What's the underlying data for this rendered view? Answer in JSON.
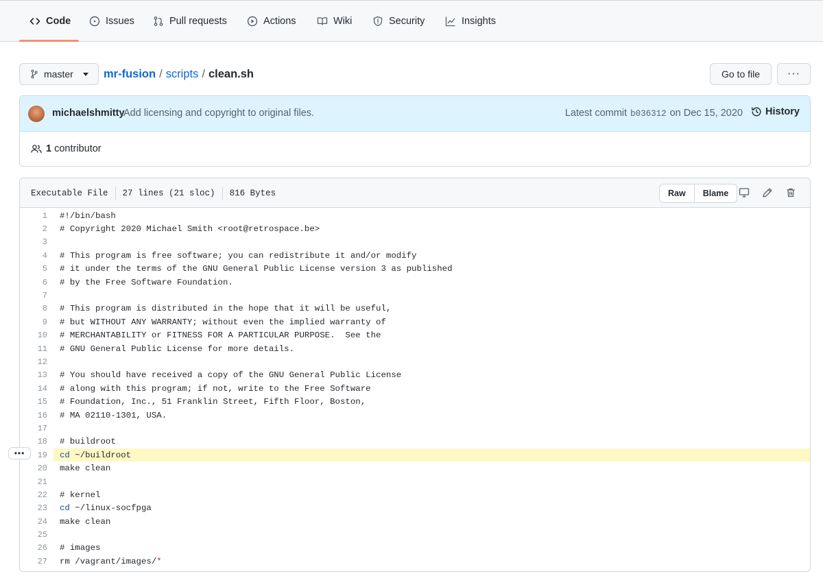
{
  "nav": {
    "tabs": [
      {
        "label": "Code",
        "icon": "code-icon"
      },
      {
        "label": "Issues",
        "icon": "issue-opened-icon"
      },
      {
        "label": "Pull requests",
        "icon": "git-pull-request-icon"
      },
      {
        "label": "Actions",
        "icon": "play-icon"
      },
      {
        "label": "Wiki",
        "icon": "book-icon"
      },
      {
        "label": "Security",
        "icon": "shield-icon"
      },
      {
        "label": "Insights",
        "icon": "graph-icon"
      }
    ],
    "selected": "Code"
  },
  "breadcrumb": {
    "branch": "master",
    "repo": "mr-fusion",
    "sep": "/",
    "dir": "scripts",
    "file": "clean.sh",
    "goto_label": "Go to file",
    "more_label": "···"
  },
  "commit": {
    "author": "michaelshmitty",
    "message": "Add licensing and copyright to original files.",
    "latest_label": "Latest commit",
    "sha": "b036312",
    "date": "on Dec 15, 2020",
    "history_label": "History",
    "contributor_count": "1",
    "contributor_label": "contributor"
  },
  "file": {
    "type": "Executable File",
    "lines": "27 lines (21 sloc)",
    "size": "816 Bytes",
    "raw_label": "Raw",
    "blame_label": "Blame",
    "highlighted_line": 19,
    "code": [
      "#!/bin/bash",
      "# Copyright 2020 Michael Smith <root@retrospace.be>",
      "",
      "# This program is free software; you can redistribute it and/or modify",
      "# it under the terms of the GNU General Public License version 3 as published",
      "# by the Free Software Foundation.",
      "",
      "# This program is distributed in the hope that it will be useful,",
      "# but WITHOUT ANY WARRANTY; without even the implied warranty of",
      "# MERCHANTABILITY or FITNESS FOR A PARTICULAR PURPOSE.  See the",
      "# GNU General Public License for more details.",
      "",
      "# You should have received a copy of the GNU General Public License",
      "# along with this program; if not, write to the Free Software",
      "# Foundation, Inc., 51 Franklin Street, Fifth Floor, Boston,",
      "# MA 02110-1301, USA.",
      "",
      "# buildroot",
      "cd ~/buildroot",
      "make clean",
      "",
      "# kernel",
      "cd ~/linux-socfpga",
      "make clean",
      "",
      "# images",
      "rm /vagrant/images/*"
    ]
  },
  "colors": {
    "accent": "#0969da",
    "tab_underline": "#fd8c73",
    "commit_bar": "#ddf4ff",
    "highlight": "#fff8c5"
  }
}
